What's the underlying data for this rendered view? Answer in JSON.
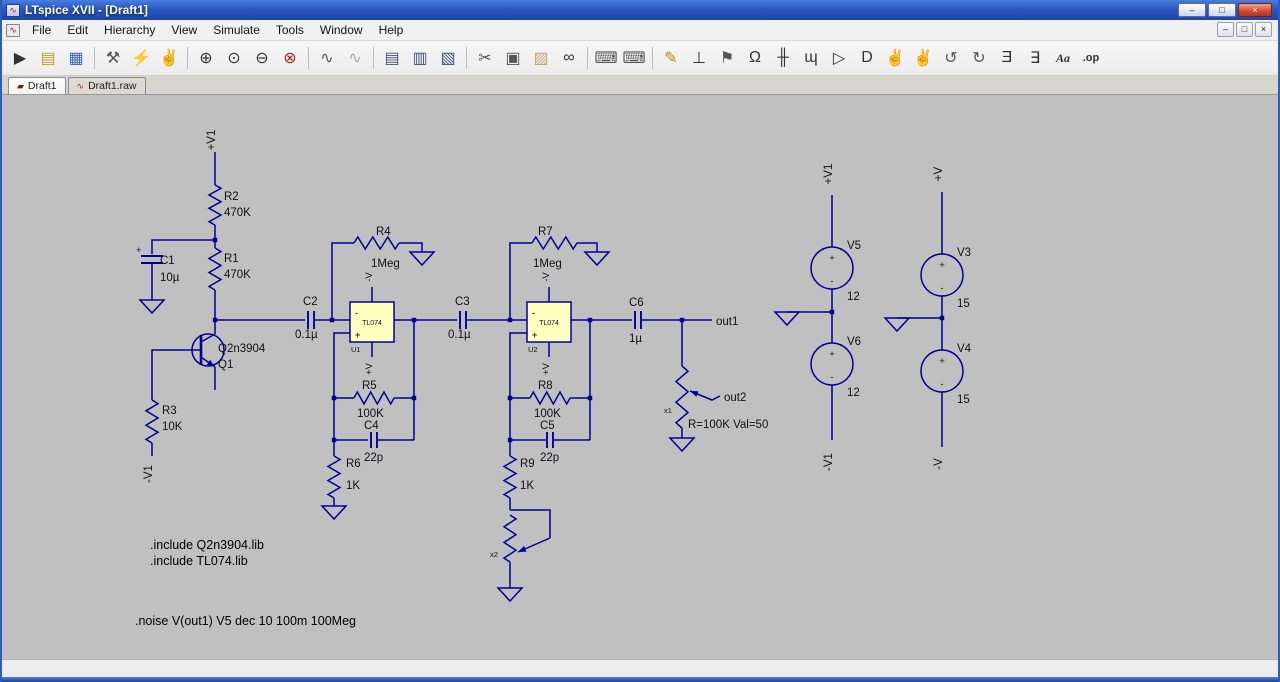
{
  "window": {
    "title": "LTspice XVII - [Draft1]",
    "controls": {
      "minimize": "–",
      "maximize": "□",
      "close": "×"
    },
    "app_icon_glyph": "∿"
  },
  "menu": {
    "items": [
      {
        "label": "File"
      },
      {
        "label": "Edit"
      },
      {
        "label": "Hierarchy"
      },
      {
        "label": "View"
      },
      {
        "label": "Simulate"
      },
      {
        "label": "Tools"
      },
      {
        "label": "Window"
      },
      {
        "label": "Help"
      }
    ],
    "mdi_controls": {
      "minimize": "–",
      "restore": "□",
      "close": "×"
    }
  },
  "toolbar": {
    "icons": [
      {
        "name": "run",
        "glyph": "▶"
      },
      {
        "name": "open",
        "glyph": "▤"
      },
      {
        "name": "save",
        "glyph": "▦"
      },
      {
        "name": "control-panel",
        "glyph": "⚒"
      },
      {
        "name": "run-man",
        "glyph": "⚡"
      },
      {
        "name": "halt",
        "glyph": "✌"
      },
      {
        "name": "zoom-in",
        "glyph": "⊕"
      },
      {
        "name": "zoom-pan",
        "glyph": "⊙"
      },
      {
        "name": "zoom-out",
        "glyph": "⊖"
      },
      {
        "name": "zoom-full",
        "glyph": "⊗"
      },
      {
        "name": "plot-settings",
        "glyph": "∿"
      },
      {
        "name": "autorange",
        "glyph": "∿"
      },
      {
        "name": "netlist",
        "glyph": "▤"
      },
      {
        "name": "bom",
        "glyph": "▥"
      },
      {
        "name": "efficiency-report",
        "glyph": "▧"
      },
      {
        "name": "cut",
        "glyph": "✂"
      },
      {
        "name": "copy",
        "glyph": "▣"
      },
      {
        "name": "paste",
        "glyph": "▨"
      },
      {
        "name": "find",
        "glyph": "∞"
      },
      {
        "name": "print",
        "glyph": "⌨"
      },
      {
        "name": "print-setup",
        "glyph": "⌨"
      },
      {
        "name": "wire",
        "glyph": "✎"
      },
      {
        "name": "ground",
        "glyph": "⊥"
      },
      {
        "name": "label-net",
        "glyph": "⚑"
      },
      {
        "name": "resistor",
        "glyph": "Ω"
      },
      {
        "name": "capacitor",
        "glyph": "╫"
      },
      {
        "name": "inductor",
        "glyph": "ɰ"
      },
      {
        "name": "diode",
        "glyph": "▷"
      },
      {
        "name": "component",
        "glyph": "D"
      },
      {
        "name": "move",
        "glyph": "✌"
      },
      {
        "name": "drag",
        "glyph": "✌"
      },
      {
        "name": "undo",
        "glyph": "↺"
      },
      {
        "name": "redo",
        "glyph": "↻"
      },
      {
        "name": "rotate",
        "glyph": "Ǝ"
      },
      {
        "name": "mirror",
        "glyph": "∃"
      },
      {
        "name": "text",
        "glyph": "Aa"
      },
      {
        "name": "spice-directive",
        "glyph": ".op"
      }
    ]
  },
  "tabs": [
    {
      "icon": "▰",
      "label": "Draft1"
    },
    {
      "icon": "∿",
      "label": "Draft1.raw"
    }
  ],
  "schematic": {
    "power_rails": {
      "vplus1": "+V1",
      "vminus1": "-V1",
      "vplus": "+V",
      "vminus": "-V"
    },
    "opamp_power": {
      "top": "-V",
      "bottom": "+V"
    },
    "nets": {
      "out1": "out1",
      "out2": "out2"
    },
    "marks": {
      "plus": "+",
      "minus": "-"
    },
    "parts": {
      "r1": {
        "ref": "R1",
        "value": "470K"
      },
      "r2": {
        "ref": "R2",
        "value": "470K"
      },
      "r3": {
        "ref": "R3",
        "value": "10K"
      },
      "r4": {
        "ref": "R4",
        "value": "1Meg"
      },
      "r5": {
        "ref": "R5",
        "value": "100K"
      },
      "r6": {
        "ref": "R6",
        "value": "1K"
      },
      "r7": {
        "ref": "R7",
        "value": "1Meg"
      },
      "r8": {
        "ref": "R8",
        "value": "100K"
      },
      "r9": {
        "ref": "R9",
        "value": "1K"
      },
      "c1": {
        "ref": "C1",
        "value": "10µ"
      },
      "c2": {
        "ref": "C2",
        "value": "0.1µ"
      },
      "c3": {
        "ref": "C3",
        "value": "0.1µ"
      },
      "c4": {
        "ref": "C4",
        "value": "22p"
      },
      "c5": {
        "ref": "C5",
        "value": "22p"
      },
      "c6": {
        "ref": "C6",
        "value": "1µ"
      },
      "q1": {
        "ref": "Q1",
        "model": "Q2n3904"
      },
      "u1": {
        "ref": "U1",
        "type": "TL074"
      },
      "u2": {
        "ref": "U2",
        "type": "TL074"
      },
      "v5": {
        "ref": "V5",
        "value": "12"
      },
      "v6": {
        "ref": "V6",
        "value": "12"
      },
      "v3": {
        "ref": "V3",
        "value": "15"
      },
      "v4": {
        "ref": "V4",
        "value": "15"
      },
      "pot1": {
        "ref": "x1",
        "value": "R=100K Val=50"
      },
      "pot2": {
        "ref": "x2"
      }
    },
    "directives": {
      "lib1": ".include Q2n3904.lib",
      "lib2": ".include TL074.lib",
      "noise": ".noise V(out1) V5 dec 10 100m 100Meg"
    }
  },
  "colors": {
    "canvas": "#c0c0c0",
    "wire": "#000096",
    "opamp_fill": "#ffffc0",
    "titlebar": "#2a57c2",
    "close_button": "#d04a30"
  }
}
